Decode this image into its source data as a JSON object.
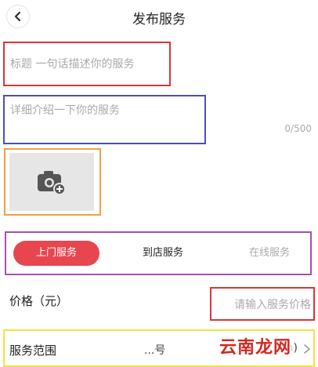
{
  "header": {
    "title": "发布服务",
    "back_icon": "chevron-left-icon"
  },
  "form": {
    "title_placeholder": "标题 一句话描述你的服务",
    "description_placeholder": "详细介绍一下你的服务",
    "char_counter": "0/500",
    "photo_icon": "camera-add-icon"
  },
  "service_modes": {
    "tabs": [
      "上门服务",
      "到店服务",
      "在线服务"
    ],
    "selected": "上门服务"
  },
  "price": {
    "label": "价格（元）",
    "placeholder": "请输入服务价格"
  },
  "range": {
    "label": "服务范围",
    "value": "...号",
    "unit": "m)"
  },
  "watermark": "云南龙网",
  "colors": {
    "accent": "#e8464e",
    "annotation_red": "#d9363e",
    "annotation_blue": "#4e4fb5",
    "annotation_orange": "#f0a040",
    "annotation_purple": "#a550b2",
    "annotation_yellow": "#f2e441"
  }
}
